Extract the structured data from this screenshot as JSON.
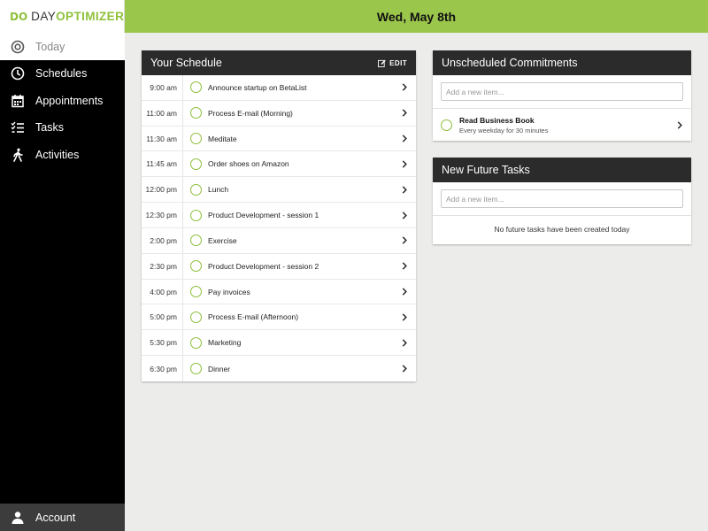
{
  "app": {
    "logo_mark": "DO",
    "logo_day": "DAY",
    "logo_optimizer": "OPTIMIZER"
  },
  "header": {
    "date": "Wed, May 8th"
  },
  "nav": {
    "items": [
      {
        "label": "Today",
        "icon": "target-icon",
        "active": true
      },
      {
        "label": "Schedules",
        "icon": "clock-icon"
      },
      {
        "label": "Appointments",
        "icon": "calendar-icon"
      },
      {
        "label": "Tasks",
        "icon": "checklist-icon"
      },
      {
        "label": "Activities",
        "icon": "walking-person-icon"
      }
    ],
    "account": {
      "label": "Account",
      "icon": "user-icon"
    }
  },
  "schedule": {
    "title": "Your Schedule",
    "edit_label": "EDIT",
    "items": [
      {
        "time": "9:00 am",
        "label": "Announce startup on BetaList"
      },
      {
        "time": "11:00 am",
        "label": "Process E-mail (Morning)"
      },
      {
        "time": "11:30 am",
        "label": "Meditate"
      },
      {
        "time": "11:45 am",
        "label": "Order shoes on Amazon"
      },
      {
        "time": "12:00 pm",
        "label": "Lunch"
      },
      {
        "time": "12:30 pm",
        "label": "Product Development - session 1"
      },
      {
        "time": "2:00 pm",
        "label": "Exercise"
      },
      {
        "time": "2:30 pm",
        "label": "Product Development - session 2"
      },
      {
        "time": "4:00 pm",
        "label": "Pay invoices"
      },
      {
        "time": "5:00 pm",
        "label": "Process E-mail (Afternoon)"
      },
      {
        "time": "5:30 pm",
        "label": "Marketing"
      },
      {
        "time": "6:30 pm",
        "label": "Dinner"
      }
    ]
  },
  "unscheduled": {
    "title": "Unscheduled Commitments",
    "placeholder": "Add a new item...",
    "items": [
      {
        "title": "Read Business Book",
        "subtitle": "Every weekday for 30 minutes"
      }
    ]
  },
  "future": {
    "title": "New Future Tasks",
    "placeholder": "Add a new item...",
    "empty_text": "No future tasks have been created today"
  },
  "colors": {
    "accent_green": "#9bc64c",
    "circle_green": "#8fbe3a",
    "sidebar_bg": "#000000",
    "card_header_bg": "#2b2b2b",
    "page_bg": "#ececea"
  }
}
